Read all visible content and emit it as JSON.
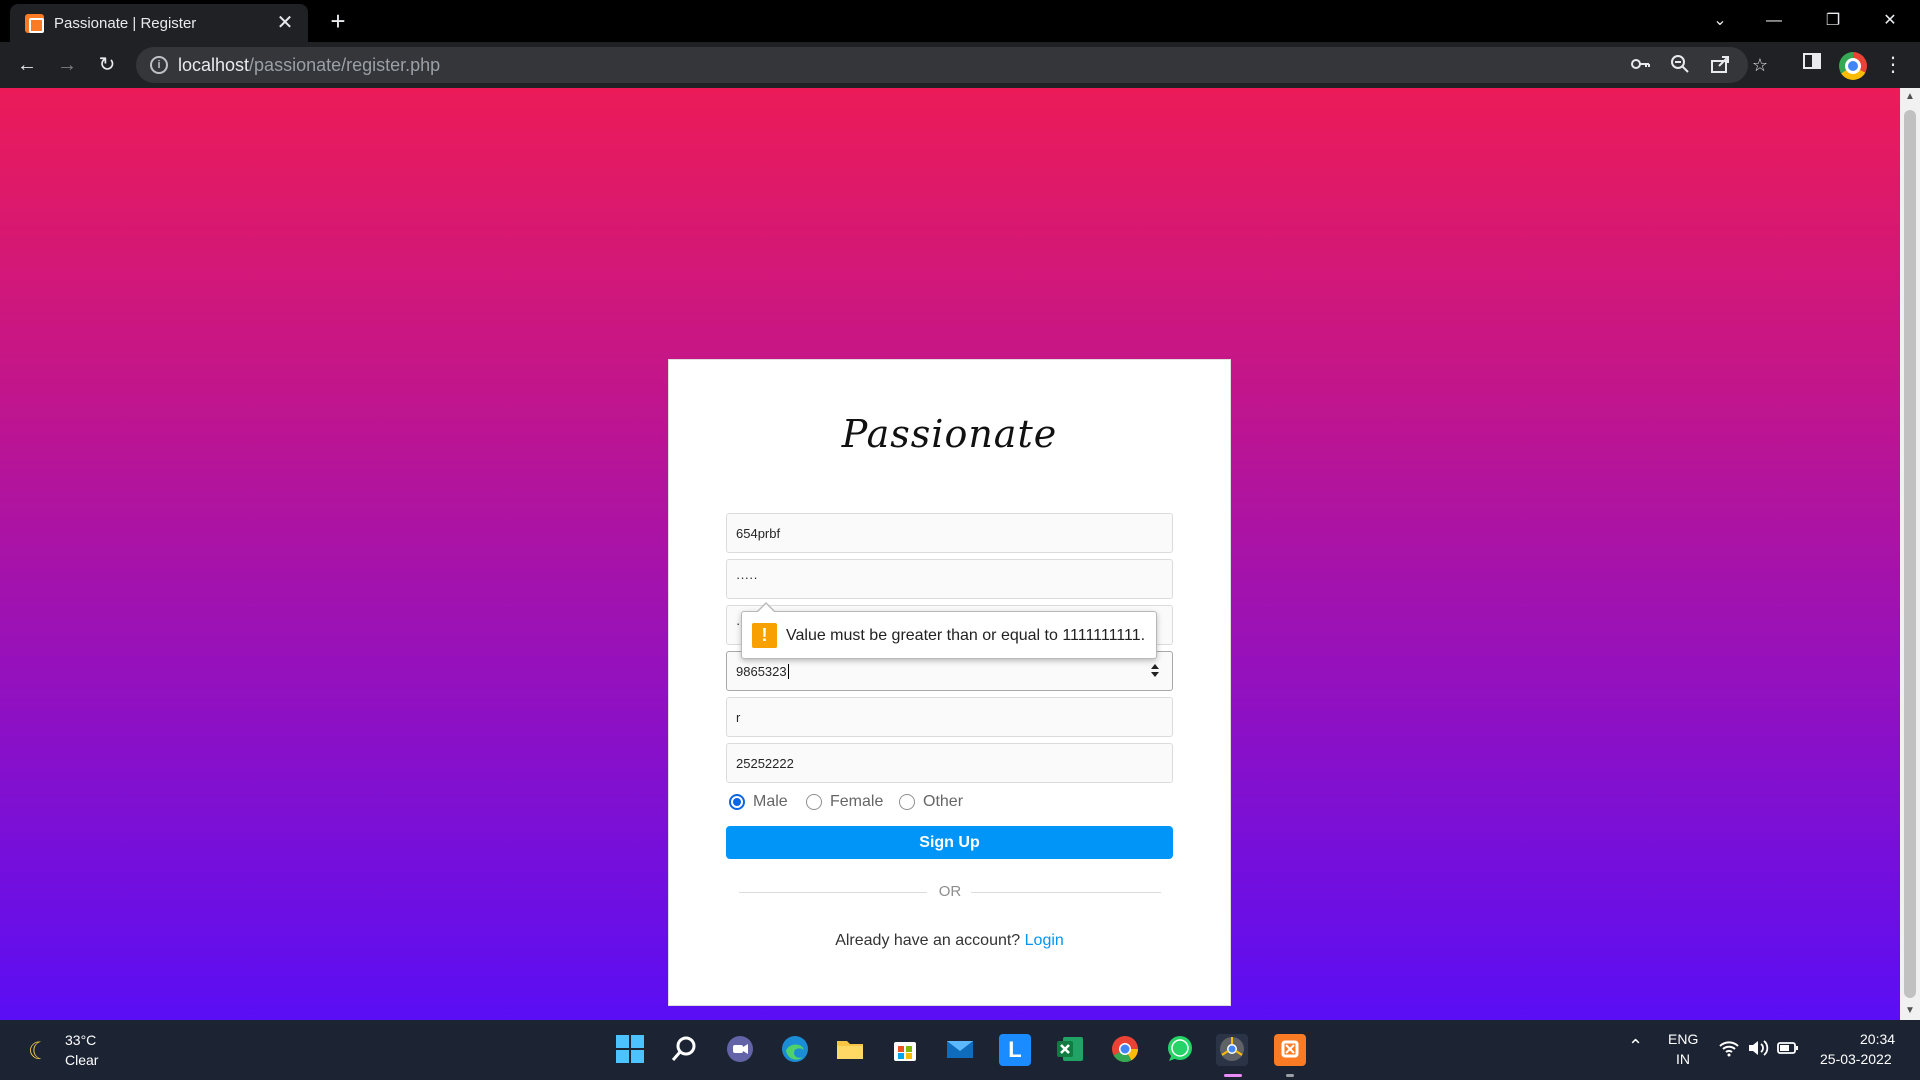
{
  "browser": {
    "tab_title": "Passionate | Register",
    "tab_close": "✕",
    "new_tab": "+",
    "url_host": "localhost",
    "url_path": "/passionate/register.php",
    "window_controls": {
      "dropdown": "⌄",
      "minimize": "—",
      "restore": "❐",
      "close": "✕"
    }
  },
  "page": {
    "brand": "Passionate",
    "fields": [
      {
        "name": "username",
        "value": "654prbf"
      },
      {
        "name": "password",
        "value": "·····"
      },
      {
        "name": "confirm-password",
        "value": "·····"
      },
      {
        "name": "phone",
        "value": "9865323"
      },
      {
        "name": "email",
        "value": "r"
      },
      {
        "name": "pincode",
        "value": "25252222"
      }
    ],
    "gender": {
      "options": [
        "Male",
        "Female",
        "Other"
      ],
      "selected": "Male"
    },
    "signup_label": "Sign Up",
    "or_text": "OR",
    "login_prompt": "Already have an account?",
    "login_link": "Login",
    "validation_tooltip": "Value must be greater than or equal to 1111111111.",
    "warn_glyph": "!"
  },
  "taskbar": {
    "weather_temp": "33°C",
    "weather_desc": "Clear",
    "lang_top": "ENG",
    "lang_bottom": "IN",
    "time": "20:34",
    "date": "25-03-2022",
    "apps": [
      "start",
      "search",
      "teams",
      "edge",
      "file-explorer",
      "store",
      "mail",
      "l-app",
      "excel",
      "chrome",
      "whatsapp",
      "chrome-dev",
      "xampp"
    ]
  },
  "colors": {
    "accent": "#0095f6",
    "radio_checked": "#0b66e4",
    "warning": "#f8a000",
    "gradient_top": "#ec1b58",
    "gradient_bottom": "#5a0ef5"
  }
}
